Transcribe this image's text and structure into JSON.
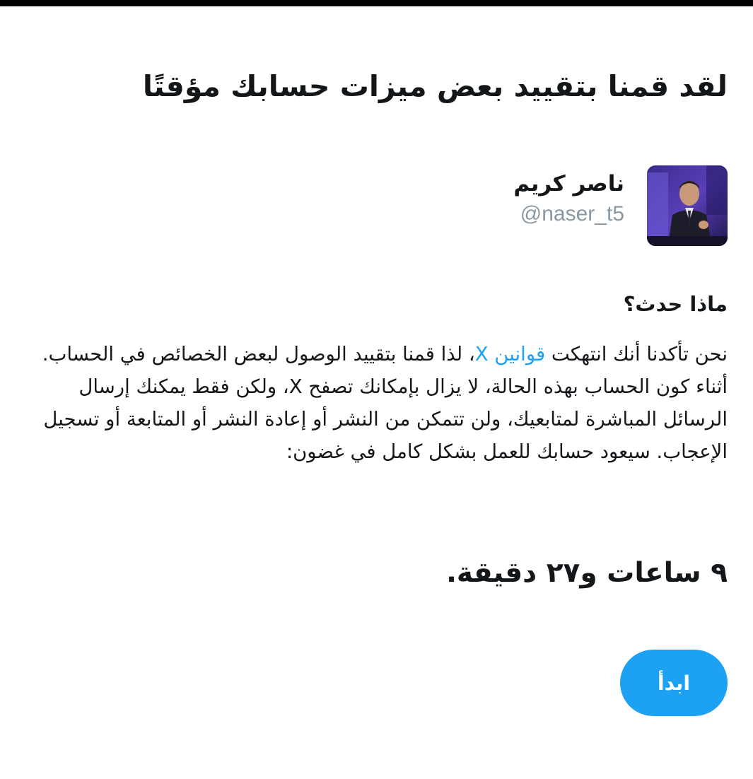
{
  "header": {
    "title": "لقد قمنا بتقييد بعض ميزات حسابك مؤقتًا"
  },
  "account": {
    "display_name": "ناصر كريم",
    "handle": "@naser_t5"
  },
  "section": {
    "heading": "ماذا حدث؟"
  },
  "body": {
    "part1": "نحن تأكدنا أنك انتهكت ",
    "link_text": "قوانين X",
    "part2": "، لذا قمنا بتقييد الوصول لبعض الخصائص في الحساب. أثناء كون الحساب بهذه الحالة، لا يزال بإمكانك تصفح X، ولكن فقط يمكنك إرسال الرسائل المباشرة لمتابعيك، ولن تتمكن من النشر أو إعادة النشر أو المتابعة أو تسجيل الإعجاب. سيعود حسابك للعمل بشكل كامل في غضون:"
  },
  "countdown": {
    "text": "٩ ساعات و٢٧ دقيقة."
  },
  "actions": {
    "start_label": "ابدأ"
  },
  "colors": {
    "accent": "#1da1f2",
    "handle_gray": "#8899a6",
    "text": "#14171a"
  }
}
